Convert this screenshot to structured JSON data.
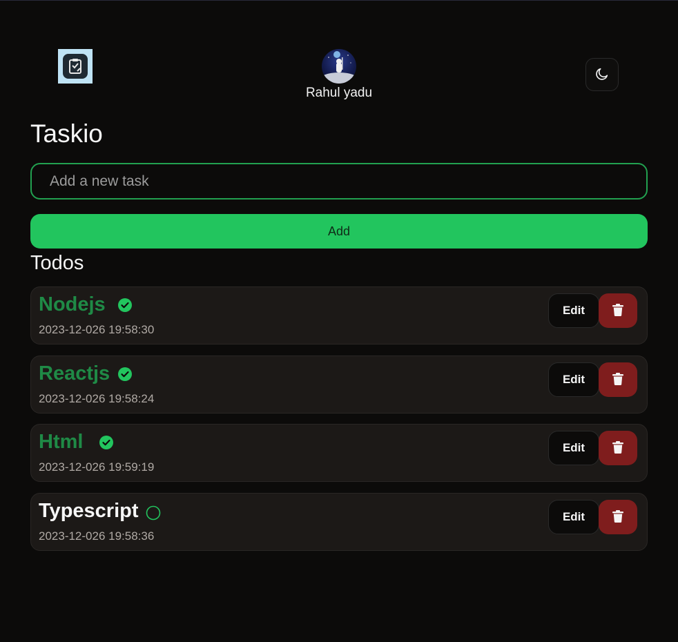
{
  "header": {
    "logo_icon": "clipboard-logo-icon",
    "user_name": "Rahul yadu",
    "avatar_icon": "astronaut-avatar",
    "theme_toggle_icon": "moon-icon"
  },
  "main": {
    "title": "Taskio",
    "input_placeholder": "Add a new task",
    "input_value": "",
    "add_label": "Add",
    "todos_heading": "Todos"
  },
  "todos": [
    {
      "title": "Nodejs",
      "date": "2023-12-026 19:58:30",
      "completed": true,
      "edit_label": "Edit",
      "delete_icon": "trash-icon"
    },
    {
      "title": "Reactjs",
      "date": "2023-12-026 19:58:24",
      "completed": true,
      "edit_label": "Edit",
      "delete_icon": "trash-icon"
    },
    {
      "title": "Html",
      "date": "2023-12-026 19:59:19",
      "completed": true,
      "edit_label": "Edit",
      "delete_icon": "trash-icon"
    },
    {
      "title": "Typescript",
      "date": "2023-12-026 19:58:36",
      "completed": false,
      "edit_label": "Edit",
      "delete_icon": "trash-icon"
    }
  ],
  "colors": {
    "background": "#0c0b0a",
    "accent": "#22c55e",
    "done_text": "#1f8a46",
    "delete": "#7f1d1d",
    "card": "#1c1917"
  }
}
